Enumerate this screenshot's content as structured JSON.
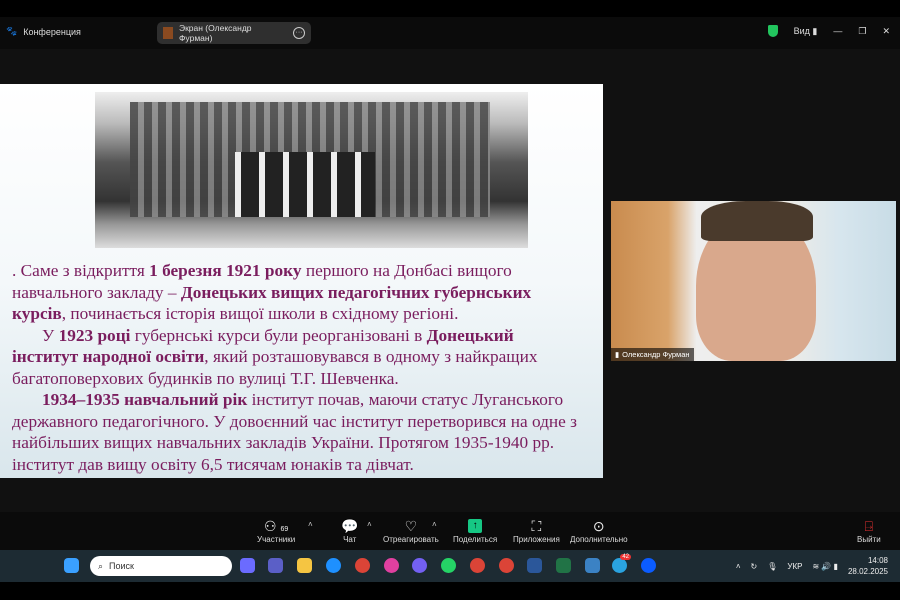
{
  "window": {
    "app_title": "Конференция",
    "share_label": "Экран (Олександр Фурман)",
    "view_label": "Вид"
  },
  "slide": {
    "lines": [
      [
        ". Саме з відкриття ",
        "1 березня 1921 року",
        " першого на Донбасі вищого"
      ],
      [
        "навчального закладу – ",
        "Донецьких вищих педагогічних губернських"
      ],
      [
        "курсів",
        ", починається історія вищої школи в східному регіоні."
      ],
      [
        "У ",
        "1923 році",
        " губернські курси були реорганізовані в ",
        "Донецький"
      ],
      [
        "інститут народної освіти",
        ", який розташовувався в одному з найкращих"
      ],
      [
        "багатоповерхових будинків по вулиці Т.Г. Шевченка."
      ],
      [
        "1934–1935 навчальний рік",
        " інститут почав, маючи статус Луганського"
      ],
      [
        "державного педагогічного. У довоєнний час інститут перетворився на одне з"
      ],
      [
        "найбільших вищих навчальних закладів України. Протягом 1935-1940 рр."
      ],
      [
        "інститут дав вищу освіту 6,5 тисячам юнаків та дівчат."
      ]
    ]
  },
  "video": {
    "participant_name": "Олександр Фурман"
  },
  "controls": {
    "participants_label": "Участники",
    "participants_count": "69",
    "chat_label": "Чат",
    "react_label": "Отреагировать",
    "share_label": "Поделиться",
    "apps_label": "Приложения",
    "more_label": "Дополнительно",
    "leave_label": "Выйти"
  },
  "taskbar": {
    "search_placeholder": "Поиск",
    "telegram_badge": "42",
    "language": "УКР",
    "time": "14:08",
    "date": "28.02.2025"
  },
  "colors": {
    "slide_text": "#7a1d5e",
    "share_green": "#16c784",
    "shield": "#22c55e"
  }
}
